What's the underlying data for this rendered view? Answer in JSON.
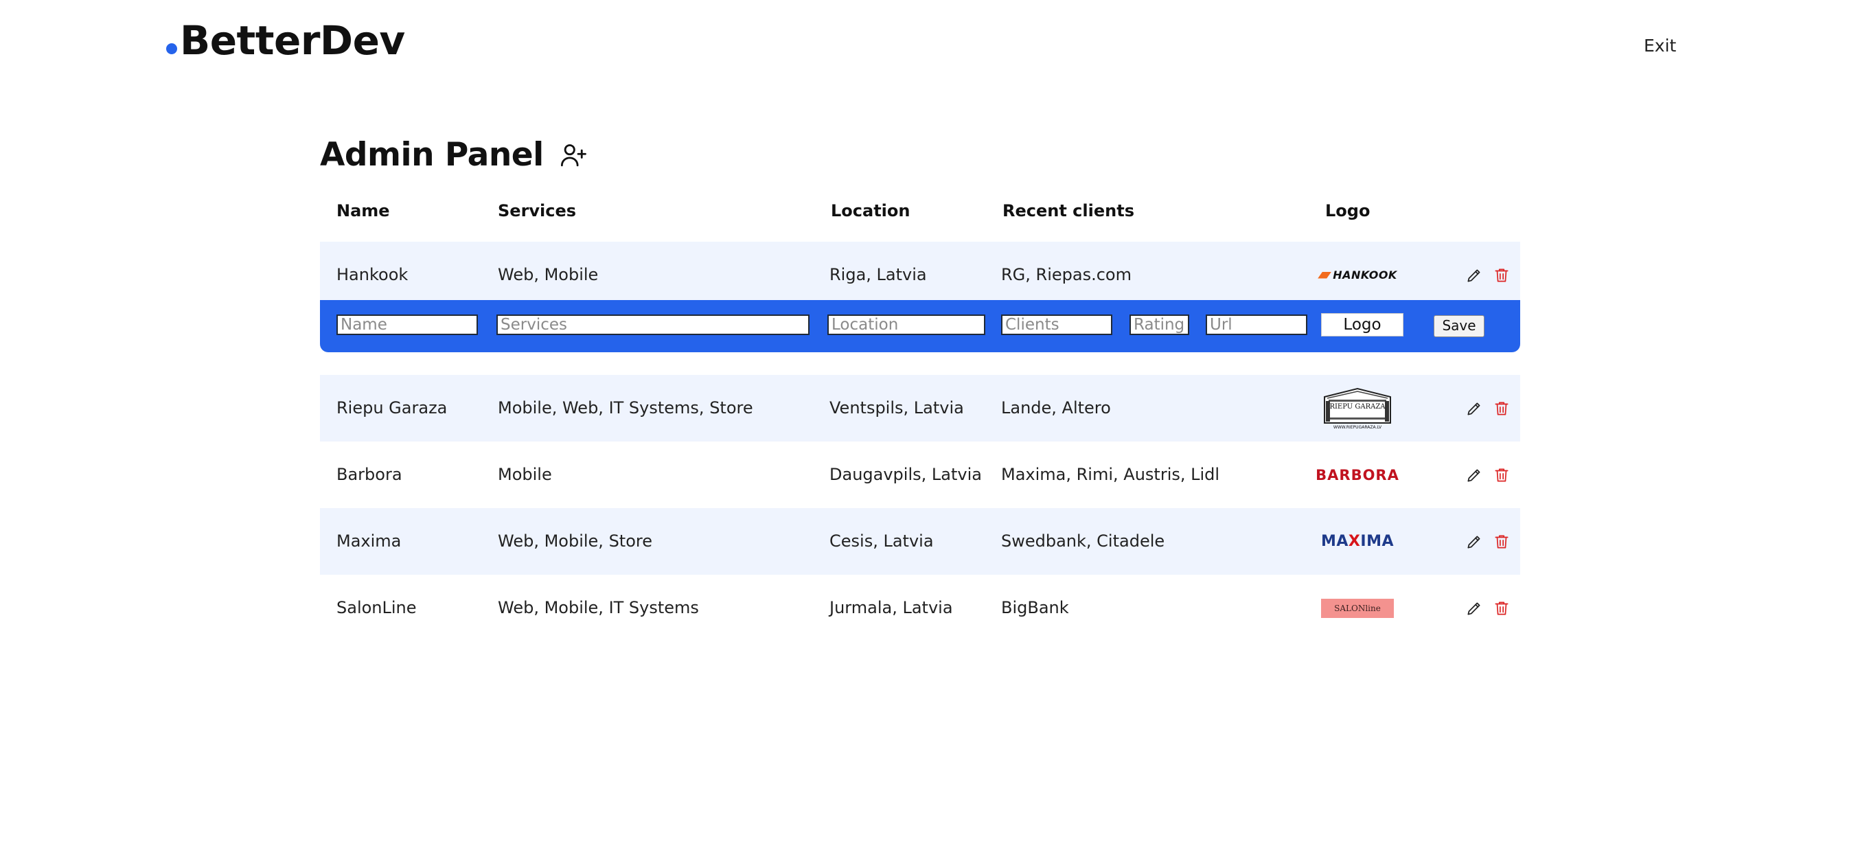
{
  "brand": {
    "name": "BetterDev",
    "accent_color": "#2563eb"
  },
  "nav": {
    "exit_label": "Exit"
  },
  "page": {
    "title": "Admin Panel",
    "add_icon": "user-plus-icon"
  },
  "table": {
    "headers": {
      "name": "Name",
      "services": "Services",
      "location": "Location",
      "clients": "Recent clients",
      "logo": "Logo"
    },
    "rows": [
      {
        "name": "Hankook",
        "services": "Web, Mobile",
        "location": "Riga, Latvia",
        "clients": "RG, Riepas.com",
        "logo_text": "HANKOOK"
      },
      {
        "name": "Riepu Garaza",
        "services": "Mobile, Web, IT Systems, Store",
        "location": "Ventspils, Latvia",
        "clients": "Lande, Altero",
        "logo_text": "RIEPU GARAZA",
        "logo_subtext": "WWW.RIEPUGARAZA.LV"
      },
      {
        "name": "Barbora",
        "services": "Mobile",
        "location": "Daugavpils, Latvia",
        "clients": "Maxima, Rimi, Austris, Lidl",
        "logo_text": "BARBORA"
      },
      {
        "name": "Maxima",
        "services": "Web, Mobile, Store",
        "location": "Cesis, Latvia",
        "clients": "Swedbank, Citadele",
        "logo_text_a": "MA",
        "logo_text_x": "X",
        "logo_text_b": "IMA"
      },
      {
        "name": "SalonLine",
        "services": "Web, Mobile, IT Systems",
        "location": "Jurmala, Latvia",
        "clients": "BigBank",
        "logo_text": "SALONline"
      }
    ],
    "row_colors": {
      "alt": "#eff4fe",
      "plain": "#ffffff"
    },
    "action_icons": {
      "edit": "pencil-icon",
      "delete": "trash-icon",
      "delete_color": "#dc2626"
    }
  },
  "edit_form": {
    "name_placeholder": "Name",
    "services_placeholder": "Services",
    "location_placeholder": "Location",
    "clients_placeholder": "Clients",
    "rating_placeholder": "Rating",
    "url_placeholder": "Url",
    "logo_button": "Logo",
    "save_button": "Save",
    "background": "#2563eb"
  }
}
